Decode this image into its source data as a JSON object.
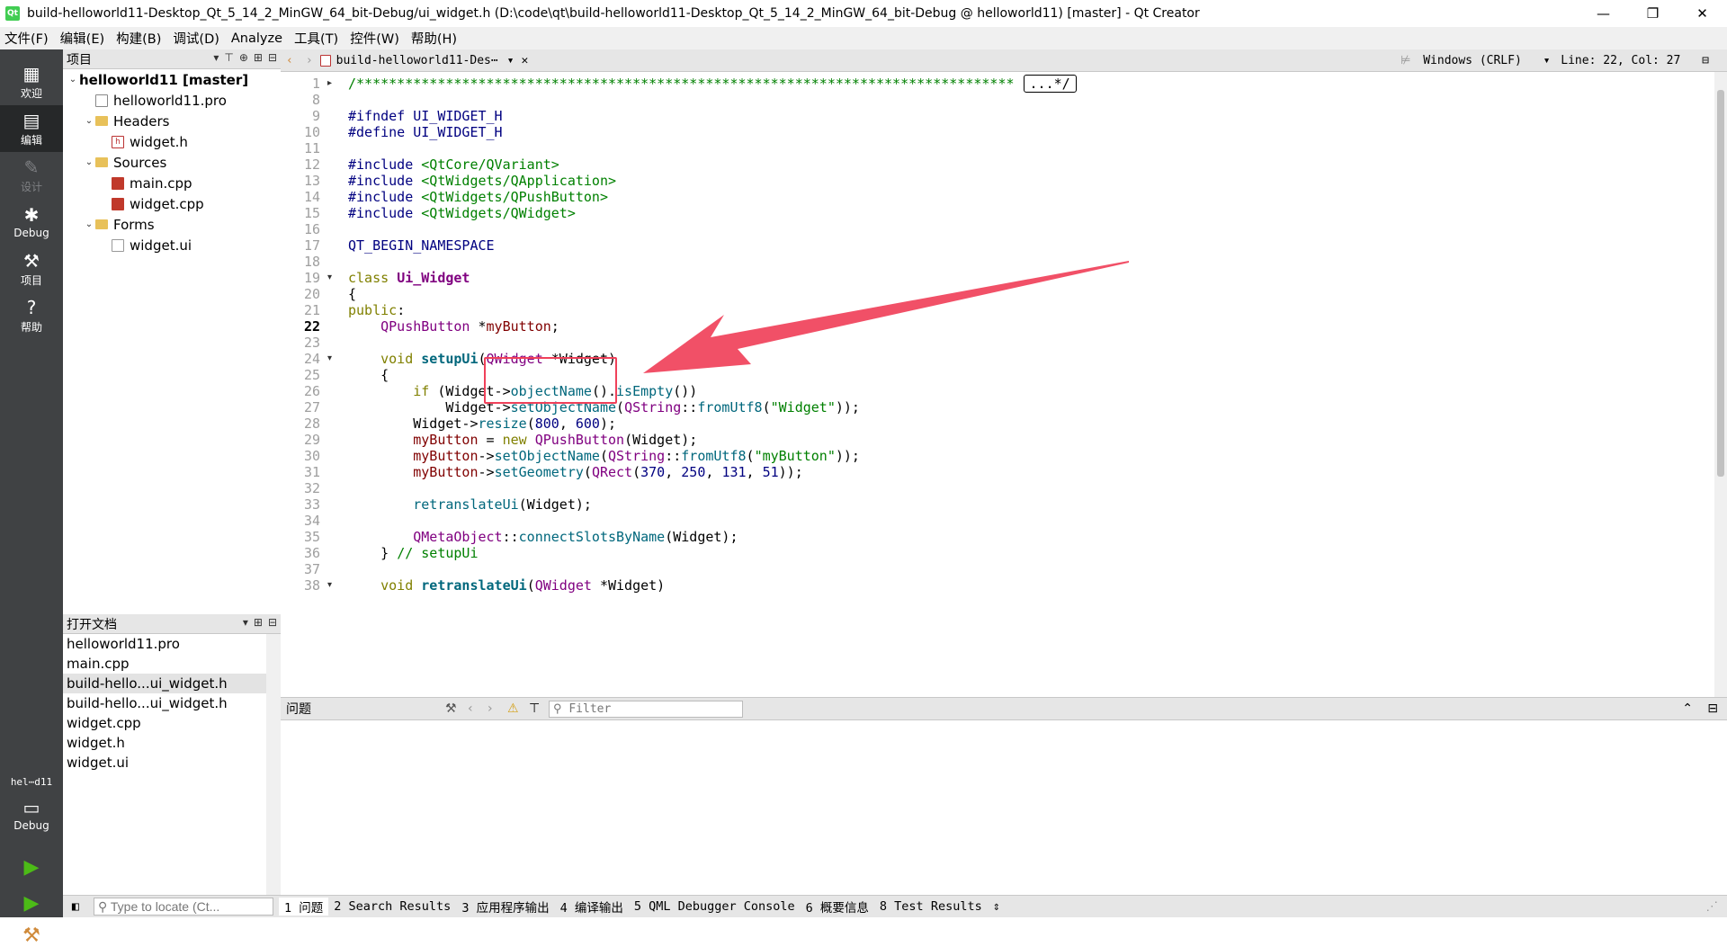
{
  "window": {
    "app_icon": "Qt",
    "title": "build-helloworld11-Desktop_Qt_5_14_2_MinGW_64_bit-Debug/ui_widget.h (D:\\code\\qt\\build-helloworld11-Desktop_Qt_5_14_2_MinGW_64_bit-Debug @ helloworld11) [master] - Qt Creator",
    "controls": [
      "—",
      "❐",
      "✕"
    ]
  },
  "menu": [
    "文件(F)",
    "编辑(E)",
    "构建(B)",
    "调试(D)",
    "Analyze",
    "工具(T)",
    "控件(W)",
    "帮助(H)"
  ],
  "modes": [
    {
      "label": "欢迎",
      "icon": "grid-icon"
    },
    {
      "label": "编辑",
      "icon": "document-icon",
      "active": true
    },
    {
      "label": "设计",
      "icon": "pencil-icon",
      "disabled": true
    },
    {
      "label": "Debug",
      "icon": "bug-icon"
    },
    {
      "label": "项目",
      "icon": "wrench-icon"
    },
    {
      "label": "帮助",
      "icon": "help-icon"
    }
  ],
  "kit": {
    "name": "hel⋯d11",
    "mode": "Debug"
  },
  "project_pane": {
    "title": "项目",
    "tree": [
      {
        "label": "helloworld11 [master]",
        "level": 0,
        "kind": "root",
        "expanded": true
      },
      {
        "label": "helloworld11.pro",
        "level": 1,
        "kind": "pro"
      },
      {
        "label": "Headers",
        "level": 1,
        "kind": "folder",
        "expanded": true
      },
      {
        "label": "widget.h",
        "level": 2,
        "kind": "h"
      },
      {
        "label": "Sources",
        "level": 1,
        "kind": "folder",
        "expanded": true
      },
      {
        "label": "main.cpp",
        "level": 2,
        "kind": "cpp"
      },
      {
        "label": "widget.cpp",
        "level": 2,
        "kind": "cpp"
      },
      {
        "label": "Forms",
        "level": 1,
        "kind": "folder",
        "expanded": true
      },
      {
        "label": "widget.ui",
        "level": 2,
        "kind": "ui"
      }
    ]
  },
  "open_docs": {
    "title": "打开文档",
    "items": [
      "helloworld11.pro",
      "main.cpp",
      "build-hello...ui_widget.h",
      "build-hello...ui_widget.h",
      "widget.cpp",
      "widget.h",
      "widget.ui"
    ],
    "selected_index": 2
  },
  "editor": {
    "tab_label": "build-helloworld11-Des⋯",
    "encoding": "Windows (CRLF)",
    "position": "Line: 22, Col: 27",
    "current_line": 22,
    "lines": [
      {
        "n": 1,
        "fold": "▸",
        "html": "<span class=\"cm\">/*********************************************************************************</span><span class=\"foldbox\">...*/</span>"
      },
      {
        "n": 8,
        "html": ""
      },
      {
        "n": 9,
        "html": "<span class=\"pp\">#ifndef UI_WIDGET_H</span>"
      },
      {
        "n": 10,
        "html": "<span class=\"pp\">#define UI_WIDGET_H</span>"
      },
      {
        "n": 11,
        "html": ""
      },
      {
        "n": 12,
        "html": "<span class=\"pp\">#include </span><span class=\"str\">&lt;QtCore/QVariant&gt;</span>"
      },
      {
        "n": 13,
        "html": "<span class=\"pp\">#include </span><span class=\"str\">&lt;QtWidgets/QApplication&gt;</span>"
      },
      {
        "n": 14,
        "html": "<span class=\"pp\">#include </span><span class=\"str\">&lt;QtWidgets/QPushButton&gt;</span>"
      },
      {
        "n": 15,
        "html": "<span class=\"pp\">#include </span><span class=\"str\">&lt;QtWidgets/QWidget&gt;</span>"
      },
      {
        "n": 16,
        "html": ""
      },
      {
        "n": 17,
        "html": "<span class=\"macro\">QT_BEGIN_NAMESPACE</span>"
      },
      {
        "n": 18,
        "html": ""
      },
      {
        "n": 19,
        "fold": "▾",
        "html": "<span class=\"kw\">class</span> <span class=\"cls\">Ui_Widget</span>"
      },
      {
        "n": 20,
        "html": "{"
      },
      {
        "n": 21,
        "html": "<span class=\"kw\">public</span>:"
      },
      {
        "n": 22,
        "html": "    <span class=\"ty\">QPushButton</span> *<span class=\"mem\">myButton</span>;"
      },
      {
        "n": 23,
        "html": ""
      },
      {
        "n": 24,
        "fold": "▾",
        "html": "    <span class=\"kw\">void</span> <span class=\"bfn\">setupUi</span>(<span class=\"ty\">QWidget</span> *Widget)"
      },
      {
        "n": 25,
        "html": "    {"
      },
      {
        "n": 26,
        "html": "        <span class=\"kw\">if</span> (Widget-&gt;<span class=\"fn\">objectName</span>().<span class=\"fn\">isEmpty</span>())"
      },
      {
        "n": 27,
        "html": "            Widget-&gt;<span class=\"fn\">setObjectName</span>(<span class=\"ty\">QString</span>::<span class=\"fn\">fromUtf8</span>(<span class=\"str\">\"Widget\"</span>));"
      },
      {
        "n": 28,
        "html": "        Widget-&gt;<span class=\"fn\">resize</span>(<span class=\"num\">800</span>, <span class=\"num\">600</span>);"
      },
      {
        "n": 29,
        "html": "        <span class=\"mem\">myButton</span> = <span class=\"kw\">new</span> <span class=\"ty\">QPushButton</span>(Widget);"
      },
      {
        "n": 30,
        "html": "        <span class=\"mem\">myButton</span>-&gt;<span class=\"fn\">setObjectName</span>(<span class=\"ty\">QString</span>::<span class=\"fn\">fromUtf8</span>(<span class=\"str\">\"myButton\"</span>));"
      },
      {
        "n": 31,
        "html": "        <span class=\"mem\">myButton</span>-&gt;<span class=\"fn\">setGeometry</span>(<span class=\"ty\">QRect</span>(<span class=\"num\">370</span>, <span class=\"num\">250</span>, <span class=\"num\">131</span>, <span class=\"num\">51</span>));"
      },
      {
        "n": 32,
        "html": ""
      },
      {
        "n": 33,
        "html": "        <span class=\"fn\">retranslateUi</span>(Widget);"
      },
      {
        "n": 34,
        "html": ""
      },
      {
        "n": 35,
        "html": "        <span class=\"ty\">QMetaObject</span>::<span class=\"fn\">connectSlotsByName</span>(Widget);"
      },
      {
        "n": 36,
        "html": "    } <span class=\"cm\">// setupUi</span>"
      },
      {
        "n": 37,
        "html": ""
      },
      {
        "n": 38,
        "fold": "▾",
        "html": "    <span class=\"kw\">void</span> <span class=\"bfn\">retranslateUi</span>(<span class=\"ty\">QWidget</span> *Widget)"
      }
    ]
  },
  "issues": {
    "title": "问题",
    "filter_placeholder": "Filter"
  },
  "status": {
    "locator_placeholder": "Type to locate (Ct...",
    "tabs": [
      "1 问题",
      "2 Search Results",
      "3 应用程序输出",
      "4 编译输出",
      "5 QML Debugger Console",
      "6 概要信息",
      "8 Test Results"
    ]
  },
  "colors": {
    "annotation": "#f0415a",
    "mode_bar": "#404244",
    "run_green": "#4cbb17"
  }
}
